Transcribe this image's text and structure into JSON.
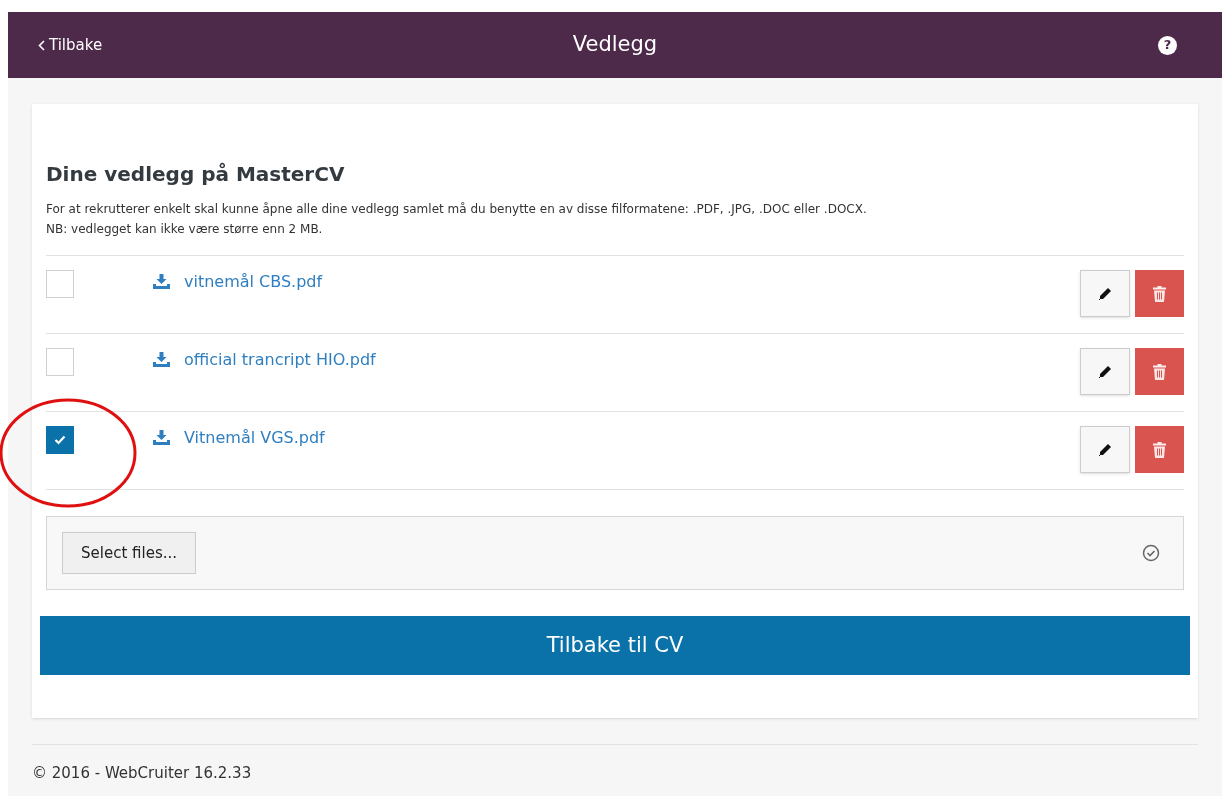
{
  "header": {
    "back": "Tilbake",
    "title": "Vedlegg",
    "help": "?"
  },
  "section": {
    "heading": "Dine vedlegg på MasterCV",
    "info": [
      "For at rekrutterer enkelt skal kunne åpne alle dine vedlegg samlet må du benytte en av disse filformatene: .PDF, .JPG, .DOC eller .DOCX.",
      "NB: vedlegget kan ikke være større enn 2 MB."
    ]
  },
  "files": [
    {
      "name": "vitnemål CBS.pdf",
      "checked": false,
      "highlighted": false
    },
    {
      "name": "official trancript HIO.pdf",
      "checked": false,
      "highlighted": false
    },
    {
      "name": "Vitnemål VGS.pdf",
      "checked": true,
      "highlighted": true
    }
  ],
  "upload": {
    "button": "Select files..."
  },
  "primary_button": "Tilbake til CV",
  "footer": "© 2016 - WebCruiter 16.2.33"
}
